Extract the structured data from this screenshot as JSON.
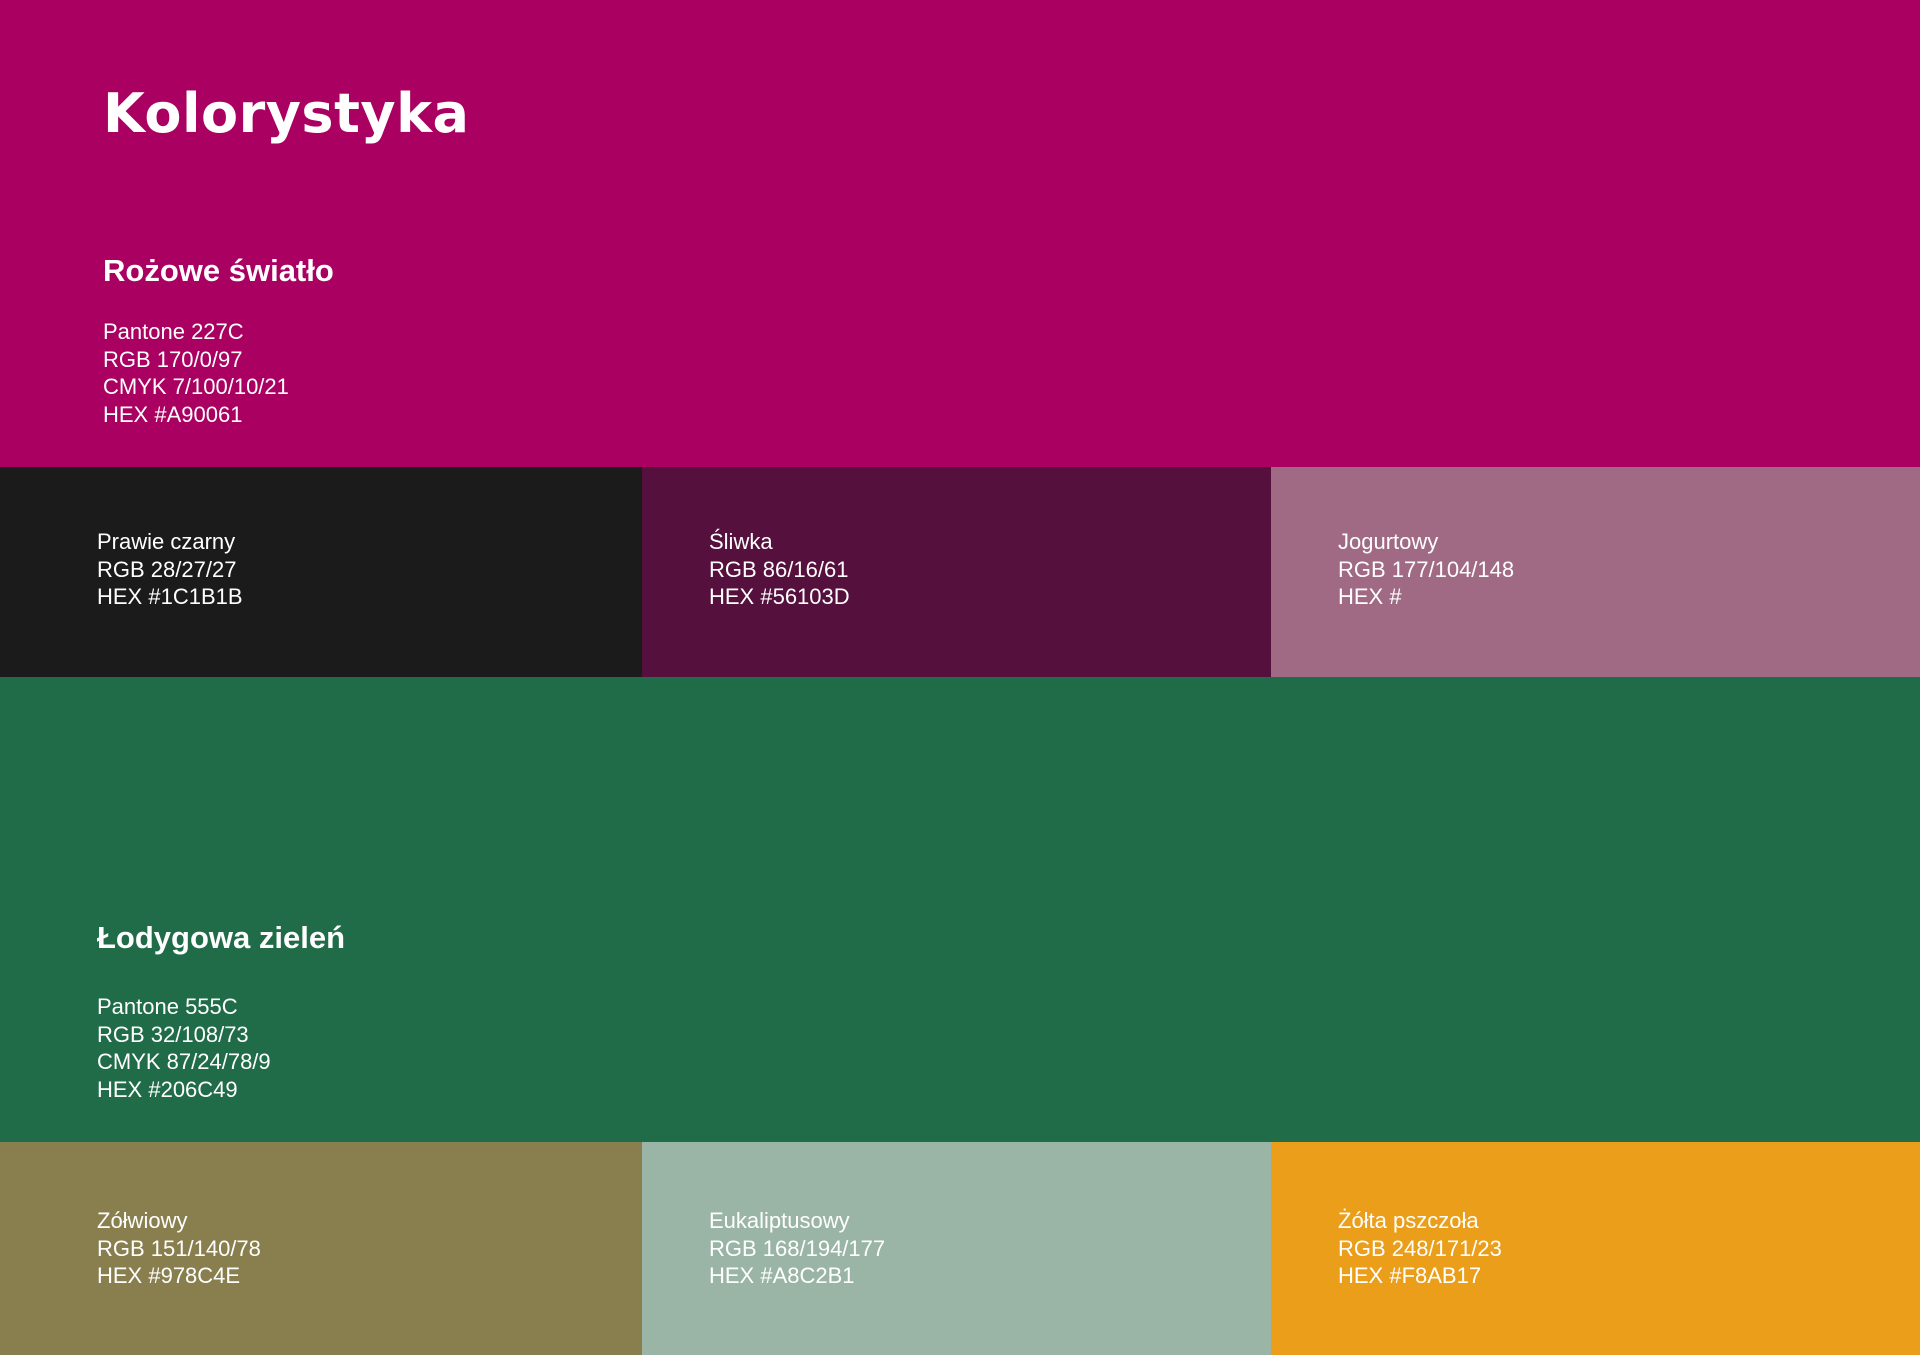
{
  "title": "Kolorystyka",
  "primary": {
    "name": "Rożowe światło",
    "color": "#A90061",
    "lines": [
      "Pantone 227C",
      "RGB 170/0/97",
      "CMYK 7/100/10/21",
      "HEX #A90061"
    ]
  },
  "row1": [
    {
      "name": "Prawie czarny",
      "color": "#1C1B1B",
      "rgb": "RGB 28/27/27",
      "hex": "HEX #1C1B1B"
    },
    {
      "name": "Śliwka",
      "color": "#56103D",
      "rgb": "RGB 86/16/61",
      "hex": "HEX #56103D"
    },
    {
      "name": "Jogurtowy",
      "color": "#A06A84",
      "rgb": "RGB 177/104/148",
      "hex": "HEX #"
    }
  ],
  "secondary": {
    "name": "Łodygowa zieleń",
    "color": "#206C49",
    "lines": [
      "Pantone 555C",
      "RGB 32/108/73",
      "CMYK 87/24/78/9",
      "HEX #206C49"
    ]
  },
  "row2": [
    {
      "name": "Zółwiowy",
      "color": "#897F4E",
      "rgb": "RGB 151/140/78",
      "hex": "HEX #978C4E"
    },
    {
      "name": "Eukaliptusowy",
      "color": "#9AB5A5",
      "rgb": "RGB 168/194/177",
      "hex": "HEX #A8C2B1"
    },
    {
      "name": "Żółta pszczoła",
      "color": "#EA9E1A",
      "rgb": "RGB 248/171/23",
      "hex": "HEX #F8AB17"
    }
  ]
}
